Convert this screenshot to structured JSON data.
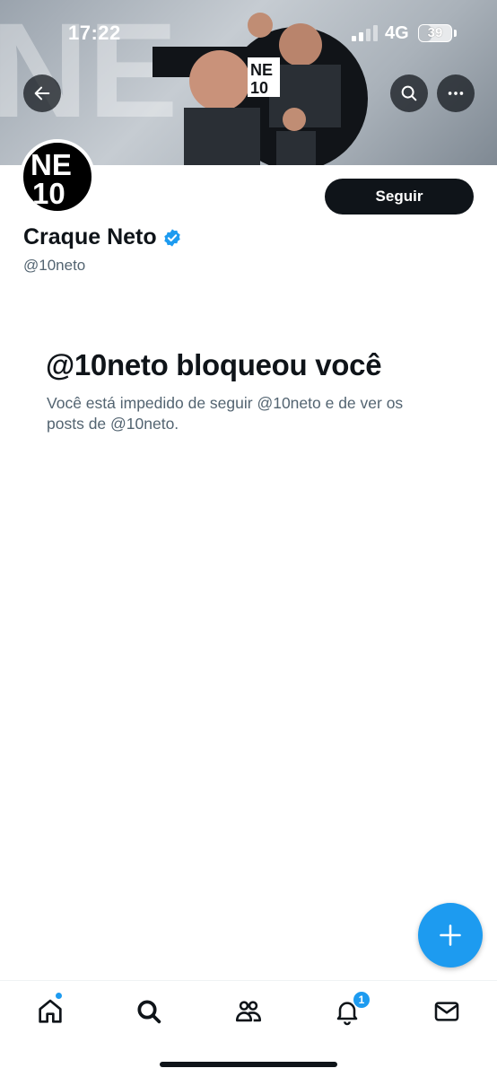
{
  "status_bar": {
    "time": "17:22",
    "network": "4G",
    "battery": "39",
    "battery_level": 0.39
  },
  "header": {
    "banner_text": "NE 10"
  },
  "profile": {
    "avatar_text_top": "NE",
    "avatar_text_bottom": "10",
    "name": "Craque Neto",
    "handle": "@10neto",
    "follow_label": "Seguir",
    "verified": true
  },
  "blocked": {
    "title": "@10neto bloqueou você",
    "description": "Você está impedido de seguir @10neto e de ver os posts de @10neto."
  },
  "fab": {
    "icon": "plus-icon"
  },
  "tabbar": {
    "items": [
      {
        "name": "home",
        "icon": "home-icon"
      },
      {
        "name": "search",
        "icon": "search-icon"
      },
      {
        "name": "communities",
        "icon": "communities-icon"
      },
      {
        "name": "notifications",
        "icon": "bell-icon",
        "badge": "1"
      },
      {
        "name": "messages",
        "icon": "mail-icon"
      }
    ]
  },
  "colors": {
    "accent": "#1d9bf0",
    "text_primary": "#0f1419",
    "text_secondary": "#536471"
  }
}
